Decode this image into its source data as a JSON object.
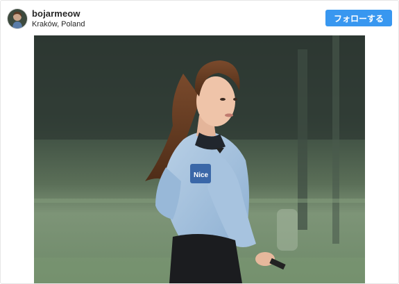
{
  "post": {
    "username": "bojarmeow",
    "location": "Kraków, Poland",
    "follow_label": "フォローする",
    "avatar_icon": "user-avatar",
    "colors": {
      "follow_button": "#3897f0",
      "username_text": "#262626"
    }
  },
  "photo": {
    "sleeve_patch_text": "Nice"
  }
}
